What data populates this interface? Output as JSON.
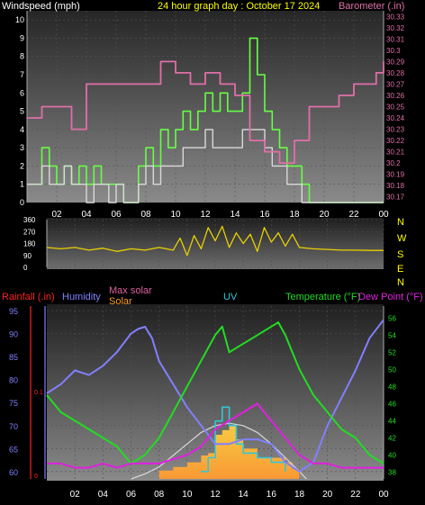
{
  "header": {
    "wind_label": "Windspeed (mph)",
    "title": "24 hour graph day : October 17 2024",
    "baro_label": "Barometer (.in)"
  },
  "bottom_header": {
    "rain_label": "Rainfall (.in)",
    "humidity_label": "Humidity",
    "max_solar_label": "Max solar",
    "solar_label": "Solar",
    "uv_label": "UV",
    "temp_label": "Temperature (°F)",
    "dew_label": "Dew Point (°F)"
  },
  "colors": {
    "wind_avg": "#d9d9d9",
    "wind_gust": "#66ff44",
    "barometer": "#e06fa8",
    "direction": "#e8d000",
    "humidity": "#8080ff",
    "temperature": "#22dd22",
    "dew_point": "#e020e0",
    "solar": "#ffa020",
    "max_solar": "#d8d8d8",
    "uv": "#30c8d8",
    "rain": "#ff2020",
    "title": "#ffff00"
  },
  "chart_data": [
    {
      "type": "line",
      "name": "wind-barometer",
      "x_ticks": [
        "02",
        "04",
        "06",
        "08",
        "10",
        "12",
        "14",
        "16",
        "18",
        "20",
        "22",
        "00"
      ],
      "y_left_ticks": [
        "0",
        "1",
        "2",
        "3",
        "4",
        "5",
        "6",
        "7",
        "8",
        "9",
        "10"
      ],
      "y_left_range": [
        0,
        10.5
      ],
      "y_right_ticks": [
        "30.17",
        "30.18",
        "30.19",
        "30.2",
        "30.21",
        "30.22",
        "30.23",
        "30.24",
        "30.25",
        "30.26",
        "30.27",
        "30.28",
        "30.29",
        "30.3",
        "30.31",
        "30.32",
        "30.33"
      ],
      "y_right_range": [
        30.165,
        30.335
      ],
      "wind_avg_x": [
        0,
        0.5,
        1,
        1.5,
        2,
        2.5,
        3,
        3.5,
        4,
        4.5,
        5,
        5.5,
        6,
        6.5,
        7,
        7.5,
        8,
        8.5,
        9,
        9.5,
        10,
        10.5,
        11,
        11.5,
        12,
        12.5,
        13,
        13.5,
        14,
        14.5,
        15,
        15.5,
        16,
        16.5,
        17,
        17.5,
        18,
        18.5,
        19,
        19.5,
        20,
        20.5,
        21,
        21.5,
        22,
        22.5,
        23,
        23.5,
        24
      ],
      "wind_avg_y": [
        1,
        1,
        2,
        1,
        1,
        2,
        1,
        1,
        0,
        1,
        1,
        0,
        1,
        0,
        0,
        1,
        2,
        1,
        2,
        2,
        2,
        3,
        3,
        3,
        4,
        3,
        3,
        3,
        3,
        4,
        4,
        4,
        3,
        2,
        2,
        1,
        1,
        0,
        0,
        0,
        0,
        0,
        0,
        0,
        0,
        0,
        0,
        0,
        0
      ],
      "wind_gust_x": [
        0,
        0.5,
        1,
        1.5,
        2,
        2.5,
        3,
        3.5,
        4,
        4.5,
        5,
        5.5,
        6,
        6.5,
        7,
        7.5,
        8,
        8.5,
        9,
        9.5,
        10,
        10.5,
        11,
        11.5,
        12,
        12.5,
        13,
        13.5,
        14,
        14.5,
        15,
        15.5,
        16,
        16.5,
        17,
        17.5,
        18,
        18.5,
        19,
        19.5,
        20,
        20.5,
        21,
        21.5,
        22,
        22.5,
        23,
        23.5,
        24
      ],
      "wind_gust_y": [
        1,
        1,
        3,
        2,
        1,
        2,
        1,
        2,
        1,
        2,
        1,
        1,
        1,
        0,
        0,
        2,
        3,
        2,
        4,
        3,
        4,
        5,
        4,
        5,
        6,
        5,
        6,
        5,
        5,
        6,
        9,
        7,
        5,
        4,
        3,
        2,
        2,
        1,
        0,
        0,
        0,
        0,
        0,
        0,
        0,
        0,
        0,
        0,
        0
      ],
      "barometer_x": [
        0,
        1,
        2,
        3,
        4,
        5,
        6,
        7,
        8,
        9,
        10,
        11,
        12,
        13,
        14,
        15,
        16,
        17,
        18,
        19,
        20,
        21,
        22,
        23,
        23.5,
        24
      ],
      "barometer_y": [
        30.24,
        30.25,
        30.25,
        30.23,
        30.27,
        30.27,
        30.27,
        30.27,
        30.27,
        30.29,
        30.28,
        30.27,
        30.28,
        30.27,
        30.26,
        30.22,
        30.21,
        30.2,
        30.22,
        30.25,
        30.25,
        30.26,
        30.27,
        30.27,
        30.28,
        30.29
      ]
    },
    {
      "type": "line",
      "name": "wind-direction",
      "x_ticks": [
        "02",
        "04",
        "06",
        "08",
        "10",
        "12",
        "14",
        "16",
        "18",
        "20",
        "22",
        "00"
      ],
      "y_ticks": [
        "360",
        "270",
        "180",
        "90",
        "0"
      ],
      "y_range": [
        0,
        360
      ],
      "compass": [
        "N",
        "W",
        "S",
        "E",
        "N"
      ],
      "x": [
        0,
        1,
        2,
        3,
        4,
        5,
        6,
        7,
        8,
        9,
        9.5,
        10,
        10.5,
        11,
        11.5,
        12,
        12.5,
        13,
        13.5,
        14,
        14.5,
        15,
        15.5,
        16,
        16.5,
        17,
        17.5,
        18,
        19,
        20,
        21,
        22,
        23,
        24
      ],
      "y": [
        150,
        140,
        150,
        130,
        145,
        120,
        140,
        130,
        150,
        130,
        220,
        90,
        240,
        140,
        300,
        200,
        310,
        150,
        260,
        180,
        250,
        120,
        300,
        190,
        260,
        160,
        250,
        150,
        140,
        135,
        130,
        130,
        128,
        128
      ]
    },
    {
      "type": "line",
      "name": "weather",
      "x_ticks": [
        "02",
        "04",
        "06",
        "08",
        "10",
        "12",
        "14",
        "16",
        "18",
        "20",
        "22",
        "00"
      ],
      "humidity_ticks": [
        "60",
        "65",
        "70",
        "75",
        "80",
        "85",
        "90",
        "95"
      ],
      "humidity_range": [
        58.4,
        96
      ],
      "temp_ticks": [
        "38",
        "40",
        "42",
        "44",
        "46",
        "48",
        "50",
        "52",
        "54",
        "56"
      ],
      "temp_range": [
        37.2,
        57.4
      ],
      "rain_ticks": [
        "0",
        "0.1"
      ],
      "humidity_x": [
        0,
        1,
        2,
        3,
        4,
        5,
        6,
        6.5,
        7,
        7.5,
        8,
        9,
        10,
        11,
        12,
        13,
        14,
        15,
        16,
        17,
        18,
        19,
        20,
        21,
        22,
        23,
        24
      ],
      "humidity_y": [
        77,
        79,
        82,
        81,
        83,
        86,
        90,
        91,
        91.5,
        89,
        84,
        79,
        74,
        70,
        66,
        66,
        67,
        67,
        66,
        62,
        60,
        62,
        70,
        76,
        82,
        89,
        93
      ],
      "temp_x": [
        0,
        1,
        2,
        3,
        4,
        5,
        6,
        7,
        8,
        9,
        10,
        11,
        12,
        12.5,
        13,
        14,
        15,
        16,
        16.5,
        17,
        18,
        19,
        20,
        21,
        22,
        23,
        24
      ],
      "temp_y": [
        47,
        45,
        44,
        43,
        42,
        41,
        39,
        40,
        42,
        45,
        48,
        51,
        54,
        55,
        52,
        53,
        54,
        55,
        55.5,
        54,
        50,
        47,
        45,
        43,
        42,
        40,
        39
      ],
      "dew_x": [
        0,
        1,
        2,
        3,
        4,
        5,
        6,
        7,
        8,
        9,
        10,
        11,
        12,
        13,
        14,
        15,
        16,
        17,
        18,
        19,
        20,
        21,
        22,
        23,
        24
      ],
      "dew_y": [
        39,
        39,
        38.5,
        38.5,
        39,
        38.5,
        39,
        39,
        39,
        39.5,
        40,
        41,
        43,
        44,
        45,
        46,
        44,
        42,
        40,
        39,
        39,
        38.5,
        38.5,
        38.5,
        38.5
      ],
      "solar_x": [
        8,
        9,
        10,
        11,
        11.5,
        12,
        12.5,
        13,
        13.5,
        14,
        15,
        16,
        17,
        17.5,
        18
      ],
      "solar_y": [
        60.2,
        61,
        62,
        63.5,
        64,
        68,
        69,
        70,
        67,
        65,
        63,
        63,
        62,
        60.5,
        59
      ],
      "max_solar_x": [
        6,
        7,
        8,
        9,
        10,
        11,
        12,
        13,
        14,
        15,
        16,
        17,
        18,
        18.5
      ],
      "max_solar_y": [
        58.4,
        59.5,
        61,
        63.5,
        66,
        68.5,
        70,
        70.5,
        70,
        68.5,
        66,
        63,
        60,
        58.4
      ],
      "uv_x": [
        11,
        11.5,
        12,
        12.5,
        13,
        13.5,
        14,
        15,
        16,
        17
      ],
      "uv_y": [
        60,
        63,
        71,
        74,
        70,
        66,
        64,
        63,
        62,
        60
      ]
    }
  ]
}
